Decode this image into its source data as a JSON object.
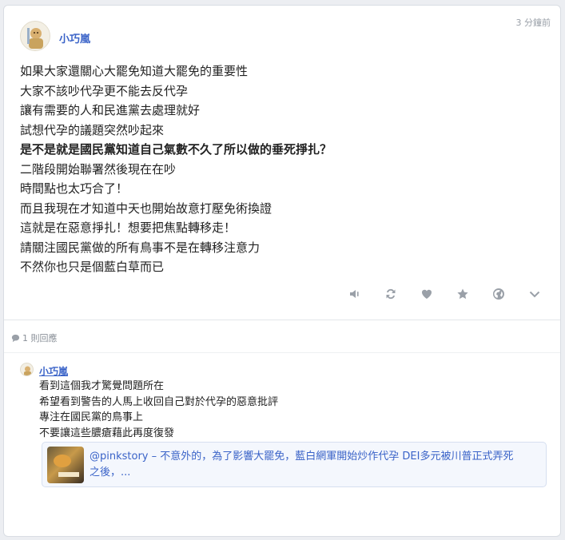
{
  "post": {
    "time_ago": "3 分鐘前",
    "author": "小巧嵐",
    "lines": [
      "如果大家還關心大罷免知道大罷免的重要性",
      "大家不該吵代孕更不能去反代孕",
      "讓有需要的人和民進黨去處理就好",
      "試想代孕的議題突然吵起來",
      "是不是就是國民黨知道自己氣數不久了所以做的垂死掙扎？",
      "二階段開始聯署然後現在在吵",
      "時間點也太巧合了！",
      "而且我現在才知道中天也開始故意打壓免術換證",
      "這就是在惡意掙扎！想要把焦點轉移走！",
      "請關注國民黨做的所有鳥事不是在轉移注意力",
      "不然你也只是個藍白草而已"
    ],
    "bold_line_index": 4,
    "actions": [
      "mute-icon",
      "repost-icon",
      "heart-icon",
      "star-icon",
      "globe-icon",
      "chevron-down-icon"
    ]
  },
  "replies": {
    "count_label": "1 則回應",
    "items": [
      {
        "author": "小巧嵐",
        "lines": [
          "看到這個我才驚覺問題所在",
          "希望看到警告的人馬上收回自己對於代孕的惡意批評",
          "專注在國民黨的鳥事上",
          "不要讓這些膿瘡藉此再度復發"
        ],
        "link_preview": {
          "text_line1": "@pinkstory – 不意外的，為了影響大罷免，藍白網軍開始炒作代孕 DEI多元被川普正式弄死",
          "text_line2": "之後，..."
        }
      }
    ]
  },
  "colors": {
    "accent": "#3a63c8",
    "icon": "#9aa0a8"
  }
}
